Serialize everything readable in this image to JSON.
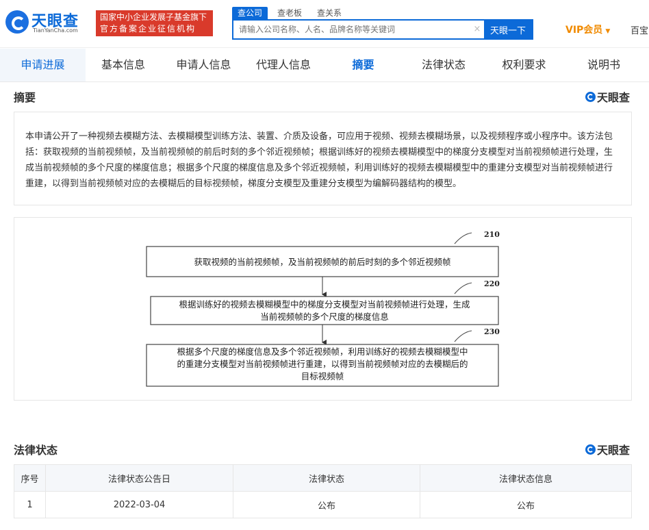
{
  "header": {
    "logo_text": "天眼查",
    "logo_sub": "TianYanCha.com",
    "badge_line1": "国家中小企业发展子基金旗下",
    "badge_line2": "官方备案企业征信机构",
    "search_tabs": [
      "查公司",
      "查老板",
      "查关系"
    ],
    "search_placeholder": "请输入公司名称、人名、品牌名称等关键词",
    "search_clear": "×",
    "search_button": "天眼一下",
    "vip_label": "VIP会员",
    "vip_caret": "▼",
    "baibao_label": "百宝"
  },
  "nav": {
    "tabs": [
      "申请进展",
      "基本信息",
      "申请人信息",
      "代理人信息",
      "摘要",
      "法律状态",
      "权利要求",
      "说明书"
    ]
  },
  "abstract": {
    "title": "摘要",
    "brand": "天眼查",
    "text": "本申请公开了一种视频去模糊方法、去模糊模型训练方法、装置、介质及设备，可应用于视频、视频去模糊场景，以及视频程序或小程序中。该方法包括：获取视频的当前视频帧，及当前视频帧的前后时刻的多个邻近视频帧；根据训练好的视频去模糊模型中的梯度分支模型对当前视频帧进行处理，生成当前视频帧的多个尺度的梯度信息；根据多个尺度的梯度信息及多个邻近视频帧，利用训练好的视频去模糊模型中的重建分支模型对当前视频帧进行重建，以得到当前视频帧对应的去模糊后的目标视频帧，梯度分支模型及重建分支模型为编解码器结构的模型。"
  },
  "figure": {
    "steps": [
      {
        "id": "210",
        "lines": [
          "获取视频的当前视频帧，及当前视频帧的前后时刻的多个邻近视频帧"
        ]
      },
      {
        "id": "220",
        "lines": [
          "根据训练好的视频去模糊模型中的梯度分支模型对当前视频帧进行处理，生成",
          "当前视频帧的多个尺度的梯度信息"
        ]
      },
      {
        "id": "230",
        "lines": [
          "根据多个尺度的梯度信息及多个邻近视频帧，利用训练好的视频去模糊模型中",
          "的重建分支模型对当前视频帧进行重建，以得到当前视频帧对应的去模糊后的",
          "目标视频帧"
        ]
      }
    ]
  },
  "legal": {
    "title": "法律状态",
    "brand": "天眼查",
    "columns": [
      "序号",
      "法律状态公告日",
      "法律状态",
      "法律状态信息"
    ],
    "rows": [
      [
        "1",
        "2022-03-04",
        "公布",
        "公布"
      ]
    ]
  }
}
